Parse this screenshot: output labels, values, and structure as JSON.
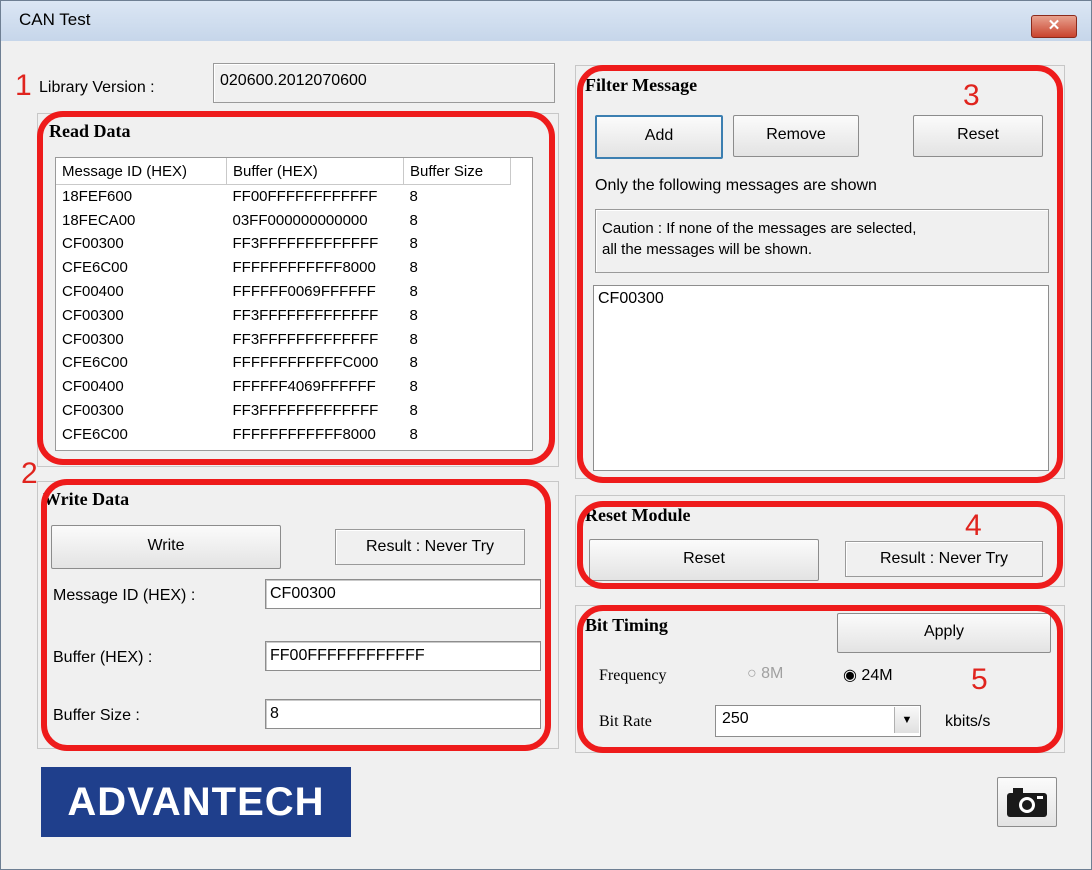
{
  "window": {
    "title": "CAN Test",
    "close_glyph": "✕"
  },
  "annotations": [
    "1",
    "2",
    "3",
    "4",
    "5"
  ],
  "library": {
    "label": "Library Version :",
    "value": "020600.2012070600"
  },
  "read_data": {
    "title": "Read Data",
    "columns": [
      "Message ID (HEX)",
      "Buffer (HEX)",
      "Buffer Size"
    ],
    "rows": [
      [
        "18FEF600",
        "FF00FFFFFFFFFFFF",
        "8"
      ],
      [
        "18FECA00",
        "03FF000000000000",
        "8"
      ],
      [
        "CF00300",
        "FF3FFFFFFFFFFFFF",
        "8"
      ],
      [
        "CFE6C00",
        "FFFFFFFFFFFF8000",
        "8"
      ],
      [
        "CF00400",
        "FFFFFF0069FFFFFF",
        "8"
      ],
      [
        "CF00300",
        "FF3FFFFFFFFFFFFF",
        "8"
      ],
      [
        "CF00300",
        "FF3FFFFFFFFFFFFF",
        "8"
      ],
      [
        "CFE6C00",
        "FFFFFFFFFFFFC000",
        "8"
      ],
      [
        "CF00400",
        "FFFFFF4069FFFFFF",
        "8"
      ],
      [
        "CF00300",
        "FF3FFFFFFFFFFFFF",
        "8"
      ],
      [
        "CFE6C00",
        "FFFFFFFFFFFF8000",
        "8"
      ]
    ]
  },
  "write_data": {
    "title": "Write Data",
    "write_button": "Write",
    "result": "Result : Never Try",
    "message_id_label": "Message ID (HEX) :",
    "message_id_value": "CF00300",
    "buffer_label": "Buffer (HEX) :",
    "buffer_value": "FF00FFFFFFFFFFFF",
    "size_label": "Buffer Size :",
    "size_value": "8"
  },
  "filter": {
    "title": "Filter Message",
    "add": "Add",
    "remove": "Remove",
    "reset": "Reset",
    "info": "Only the following messages are shown",
    "caution_line1": "Caution : If none of the messages are selected,",
    "caution_line2": "all the messages will be shown.",
    "items": [
      "CF00300"
    ]
  },
  "reset_module": {
    "title": "Reset Module",
    "reset": "Reset",
    "result": "Result : Never Try"
  },
  "bit_timing": {
    "title": "Bit Timing",
    "apply": "Apply",
    "frequency_label": "Frequency",
    "freq_8m": "8M",
    "freq_24m": "24M",
    "selected_frequency": "24M",
    "bitrate_label": "Bit Rate",
    "bitrate_value": "250",
    "bitrate_unit": "kbits/s"
  },
  "logo": {
    "text": "ADVANTECH"
  },
  "icons": [
    "close-icon",
    "dropdown-arrow-icon",
    "camera-icon",
    "radio-icon"
  ],
  "colors": {
    "annotation": "#ee1b1b",
    "logo_bg": "#1f3f8c",
    "title_bar": "#c6d6ea"
  }
}
